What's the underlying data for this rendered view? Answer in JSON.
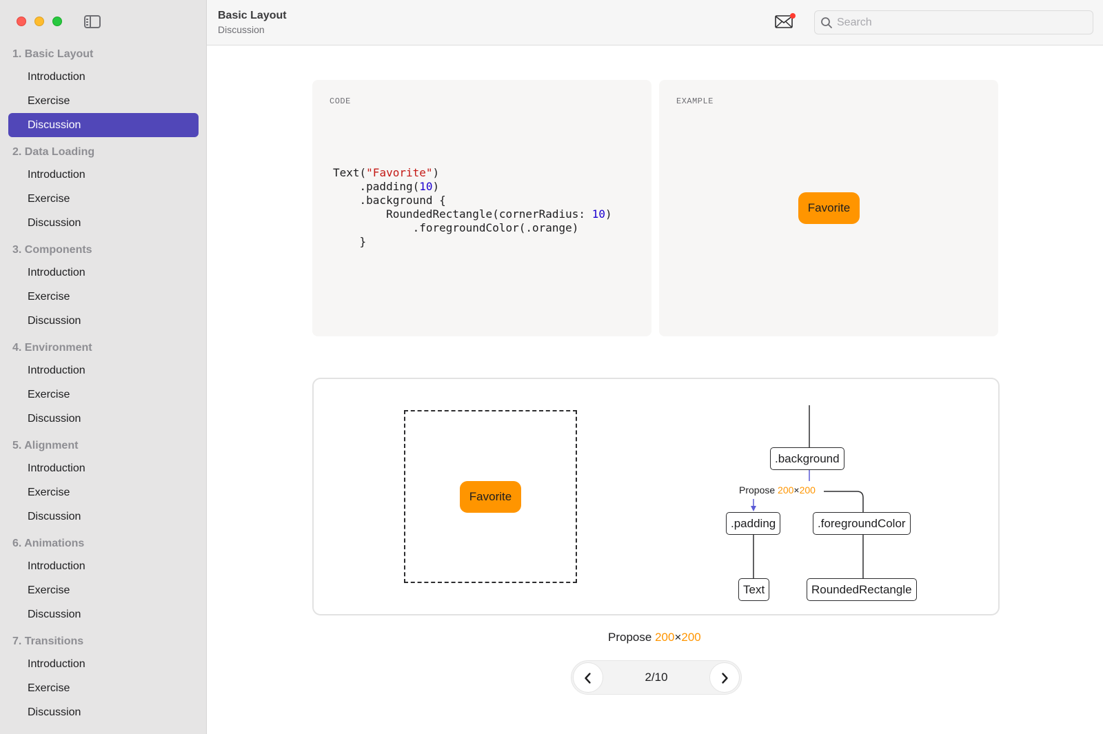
{
  "window": {
    "title": "Basic Layout",
    "subtitle": "Discussion"
  },
  "search": {
    "placeholder": "Search"
  },
  "sidebar": {
    "sections": [
      {
        "title": "1. Basic Layout",
        "items": [
          "Introduction",
          "Exercise",
          "Discussion"
        ]
      },
      {
        "title": "2. Data Loading",
        "items": [
          "Introduction",
          "Exercise",
          "Discussion"
        ]
      },
      {
        "title": "3. Components",
        "items": [
          "Introduction",
          "Exercise",
          "Discussion"
        ]
      },
      {
        "title": "4. Environment",
        "items": [
          "Introduction",
          "Exercise",
          "Discussion"
        ]
      },
      {
        "title": "5. Alignment",
        "items": [
          "Introduction",
          "Exercise",
          "Discussion"
        ]
      },
      {
        "title": "6. Animations",
        "items": [
          "Introduction",
          "Exercise",
          "Discussion"
        ]
      },
      {
        "title": "7. Transitions",
        "items": [
          "Introduction",
          "Exercise",
          "Discussion"
        ]
      }
    ],
    "active": {
      "section": 0,
      "item": 2
    },
    "accent_color": "#5147b8"
  },
  "code_panel": {
    "label": "CODE",
    "lines": [
      [
        {
          "t": "Text("
        },
        {
          "t": "\"Favorite\"",
          "c": "str"
        },
        {
          "t": ")"
        }
      ],
      [
        {
          "t": "    .padding("
        },
        {
          "t": "10",
          "c": "num"
        },
        {
          "t": ")"
        }
      ],
      [
        {
          "t": "    .background {"
        }
      ],
      [
        {
          "t": "        RoundedRectangle(cornerRadius: "
        },
        {
          "t": "10",
          "c": "num"
        },
        {
          "t": ")"
        }
      ],
      [
        {
          "t": "            .foregroundColor(.orange)"
        }
      ],
      [
        {
          "t": "    }"
        }
      ]
    ]
  },
  "example_panel": {
    "label": "EXAMPLE",
    "button_label": "Favorite",
    "button_color": "#ff9500"
  },
  "diagram": {
    "button_label": "Favorite",
    "nodes": {
      "background": ".background",
      "padding": ".padding",
      "foreground": ".foregroundColor",
      "text": "Text",
      "rounded": "RoundedRectangle"
    },
    "propose": {
      "word": "Propose",
      "w": "200",
      "x": "×",
      "h": "200"
    }
  },
  "caption": {
    "word": "Propose",
    "w": "200",
    "x": "×",
    "h": "200"
  },
  "pager": {
    "current": "2/10"
  }
}
